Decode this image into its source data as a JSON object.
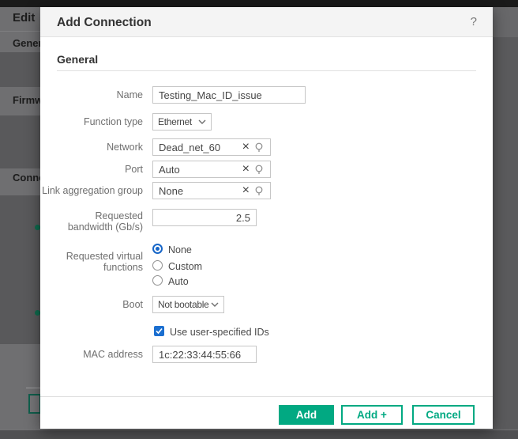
{
  "background": {
    "top_title": "Edit",
    "section_general": "Gener",
    "section_firmware": "Firmw",
    "section_connections": "Conne"
  },
  "dialog": {
    "title": "Add Connection",
    "help": "?",
    "section_heading": "General",
    "fields": {
      "name": {
        "label": "Name",
        "value": "Testing_Mac_ID_issue"
      },
      "function_type": {
        "label": "Function type",
        "value": "Ethernet"
      },
      "network": {
        "label": "Network",
        "value": "Dead_net_60"
      },
      "port": {
        "label": "Port",
        "value": "Auto"
      },
      "lag": {
        "label": "Link aggregation group",
        "value": "None"
      },
      "bandwidth": {
        "label_line1": "Requested",
        "label_line2": "bandwidth (Gb/s)",
        "value": "2.5"
      },
      "rvf": {
        "label_line1": "Requested virtual",
        "label_line2": "functions",
        "options": [
          {
            "label": "None",
            "selected": true
          },
          {
            "label": "Custom",
            "selected": false
          },
          {
            "label": "Auto",
            "selected": false
          }
        ]
      },
      "boot": {
        "label": "Boot",
        "value": "Not bootable"
      },
      "user_ids": {
        "label": "Use user-specified IDs",
        "checked": true
      },
      "mac": {
        "label": "MAC address",
        "value": "1c:22:33:44:55:66"
      }
    },
    "buttons": {
      "add": "Add",
      "add_plus": "Add +",
      "cancel": "Cancel"
    }
  },
  "icons": {
    "clear": "×"
  },
  "colors": {
    "accent_green": "#01A982",
    "radio_blue": "#1766C8",
    "checkbox_blue": "#1B6FD0"
  }
}
